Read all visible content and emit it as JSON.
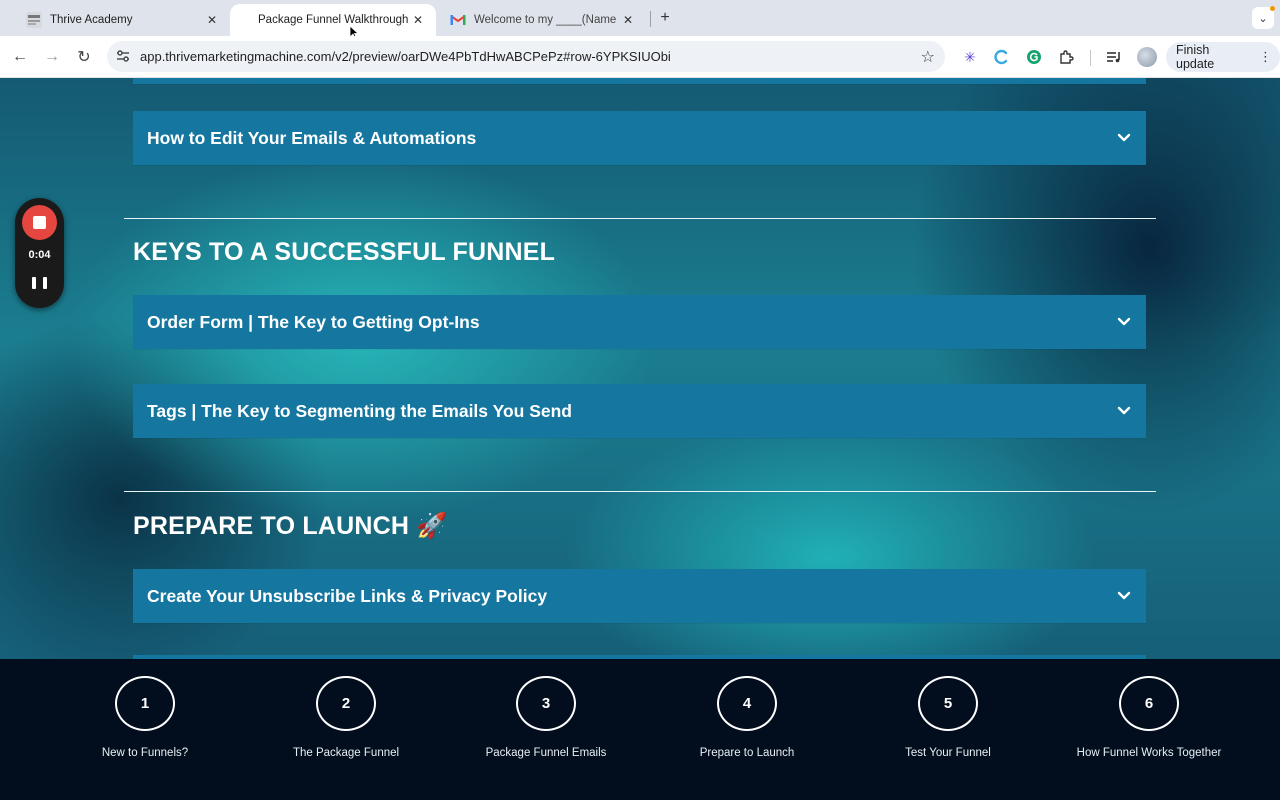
{
  "browser": {
    "tabs": [
      {
        "title": "Thrive Academy",
        "favicon": "thrive-favicon",
        "active": false
      },
      {
        "title": "Package Funnel Walkthrough",
        "favicon": "blank",
        "active": true
      },
      {
        "title": "Welcome to my ____(Name of",
        "favicon": "gmail-icon",
        "active": false
      }
    ],
    "url": "app.thrivemarketingmachine.com/v2/preview/oarDWe4PbTdHwABCPePz#row-6YPKSIUObi",
    "finish_update_label": "Finish update",
    "extensions": [
      "perplexity-icon",
      "c-extension-icon",
      "grammarly-icon",
      "puzzle-icon",
      "media-control-icon"
    ]
  },
  "recorder": {
    "time": "0:04"
  },
  "page": {
    "accordion_top": "How to Edit Your Emails & Automations",
    "sections": [
      {
        "heading": "KEYS TO A SUCCESSFUL FUNNEL",
        "items": [
          "Order Form | The Key to Getting Opt-Ins",
          "Tags | The Key to Segmenting the Emails You Send"
        ]
      },
      {
        "heading": "PREPARE TO LAUNCH 🚀",
        "items": [
          "Create Your Unsubscribe Links & Privacy Policy"
        ]
      }
    ]
  },
  "steps": [
    {
      "number": "1",
      "label": "New to Funnels?"
    },
    {
      "number": "2",
      "label": "The Package Funnel"
    },
    {
      "number": "3",
      "label": "Package Funnel Emails"
    },
    {
      "number": "4",
      "label": "Prepare to Launch"
    },
    {
      "number": "5",
      "label": "Test Your Funnel"
    },
    {
      "number": "6",
      "label": "How Funnel Works Together"
    }
  ],
  "colors": {
    "accordion_bg": "#1577a0",
    "steps_bar_bg": "#020e1d",
    "record_red": "#e5463f"
  }
}
